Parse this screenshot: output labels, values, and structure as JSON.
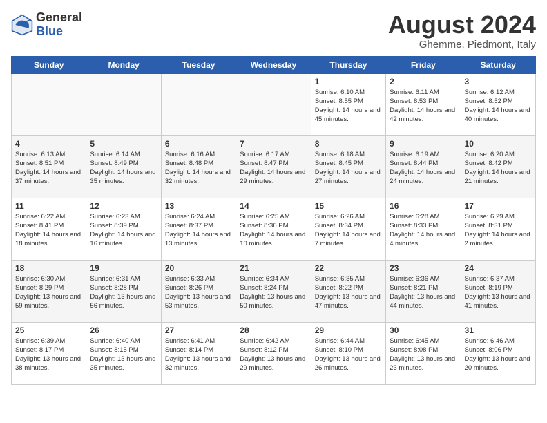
{
  "header": {
    "logo_general": "General",
    "logo_blue": "Blue",
    "month_year": "August 2024",
    "location": "Ghemme, Piedmont, Italy"
  },
  "days_of_week": [
    "Sunday",
    "Monday",
    "Tuesday",
    "Wednesday",
    "Thursday",
    "Friday",
    "Saturday"
  ],
  "weeks": [
    [
      {
        "num": "",
        "info": ""
      },
      {
        "num": "",
        "info": ""
      },
      {
        "num": "",
        "info": ""
      },
      {
        "num": "",
        "info": ""
      },
      {
        "num": "1",
        "info": "Sunrise: 6:10 AM\nSunset: 8:55 PM\nDaylight: 14 hours and 45 minutes."
      },
      {
        "num": "2",
        "info": "Sunrise: 6:11 AM\nSunset: 8:53 PM\nDaylight: 14 hours and 42 minutes."
      },
      {
        "num": "3",
        "info": "Sunrise: 6:12 AM\nSunset: 8:52 PM\nDaylight: 14 hours and 40 minutes."
      }
    ],
    [
      {
        "num": "4",
        "info": "Sunrise: 6:13 AM\nSunset: 8:51 PM\nDaylight: 14 hours and 37 minutes."
      },
      {
        "num": "5",
        "info": "Sunrise: 6:14 AM\nSunset: 8:49 PM\nDaylight: 14 hours and 35 minutes."
      },
      {
        "num": "6",
        "info": "Sunrise: 6:16 AM\nSunset: 8:48 PM\nDaylight: 14 hours and 32 minutes."
      },
      {
        "num": "7",
        "info": "Sunrise: 6:17 AM\nSunset: 8:47 PM\nDaylight: 14 hours and 29 minutes."
      },
      {
        "num": "8",
        "info": "Sunrise: 6:18 AM\nSunset: 8:45 PM\nDaylight: 14 hours and 27 minutes."
      },
      {
        "num": "9",
        "info": "Sunrise: 6:19 AM\nSunset: 8:44 PM\nDaylight: 14 hours and 24 minutes."
      },
      {
        "num": "10",
        "info": "Sunrise: 6:20 AM\nSunset: 8:42 PM\nDaylight: 14 hours and 21 minutes."
      }
    ],
    [
      {
        "num": "11",
        "info": "Sunrise: 6:22 AM\nSunset: 8:41 PM\nDaylight: 14 hours and 18 minutes."
      },
      {
        "num": "12",
        "info": "Sunrise: 6:23 AM\nSunset: 8:39 PM\nDaylight: 14 hours and 16 minutes."
      },
      {
        "num": "13",
        "info": "Sunrise: 6:24 AM\nSunset: 8:37 PM\nDaylight: 14 hours and 13 minutes."
      },
      {
        "num": "14",
        "info": "Sunrise: 6:25 AM\nSunset: 8:36 PM\nDaylight: 14 hours and 10 minutes."
      },
      {
        "num": "15",
        "info": "Sunrise: 6:26 AM\nSunset: 8:34 PM\nDaylight: 14 hours and 7 minutes."
      },
      {
        "num": "16",
        "info": "Sunrise: 6:28 AM\nSunset: 8:33 PM\nDaylight: 14 hours and 4 minutes."
      },
      {
        "num": "17",
        "info": "Sunrise: 6:29 AM\nSunset: 8:31 PM\nDaylight: 14 hours and 2 minutes."
      }
    ],
    [
      {
        "num": "18",
        "info": "Sunrise: 6:30 AM\nSunset: 8:29 PM\nDaylight: 13 hours and 59 minutes."
      },
      {
        "num": "19",
        "info": "Sunrise: 6:31 AM\nSunset: 8:28 PM\nDaylight: 13 hours and 56 minutes."
      },
      {
        "num": "20",
        "info": "Sunrise: 6:33 AM\nSunset: 8:26 PM\nDaylight: 13 hours and 53 minutes."
      },
      {
        "num": "21",
        "info": "Sunrise: 6:34 AM\nSunset: 8:24 PM\nDaylight: 13 hours and 50 minutes."
      },
      {
        "num": "22",
        "info": "Sunrise: 6:35 AM\nSunset: 8:22 PM\nDaylight: 13 hours and 47 minutes."
      },
      {
        "num": "23",
        "info": "Sunrise: 6:36 AM\nSunset: 8:21 PM\nDaylight: 13 hours and 44 minutes."
      },
      {
        "num": "24",
        "info": "Sunrise: 6:37 AM\nSunset: 8:19 PM\nDaylight: 13 hours and 41 minutes."
      }
    ],
    [
      {
        "num": "25",
        "info": "Sunrise: 6:39 AM\nSunset: 8:17 PM\nDaylight: 13 hours and 38 minutes."
      },
      {
        "num": "26",
        "info": "Sunrise: 6:40 AM\nSunset: 8:15 PM\nDaylight: 13 hours and 35 minutes."
      },
      {
        "num": "27",
        "info": "Sunrise: 6:41 AM\nSunset: 8:14 PM\nDaylight: 13 hours and 32 minutes."
      },
      {
        "num": "28",
        "info": "Sunrise: 6:42 AM\nSunset: 8:12 PM\nDaylight: 13 hours and 29 minutes."
      },
      {
        "num": "29",
        "info": "Sunrise: 6:44 AM\nSunset: 8:10 PM\nDaylight: 13 hours and 26 minutes."
      },
      {
        "num": "30",
        "info": "Sunrise: 6:45 AM\nSunset: 8:08 PM\nDaylight: 13 hours and 23 minutes."
      },
      {
        "num": "31",
        "info": "Sunrise: 6:46 AM\nSunset: 8:06 PM\nDaylight: 13 hours and 20 minutes."
      }
    ]
  ]
}
